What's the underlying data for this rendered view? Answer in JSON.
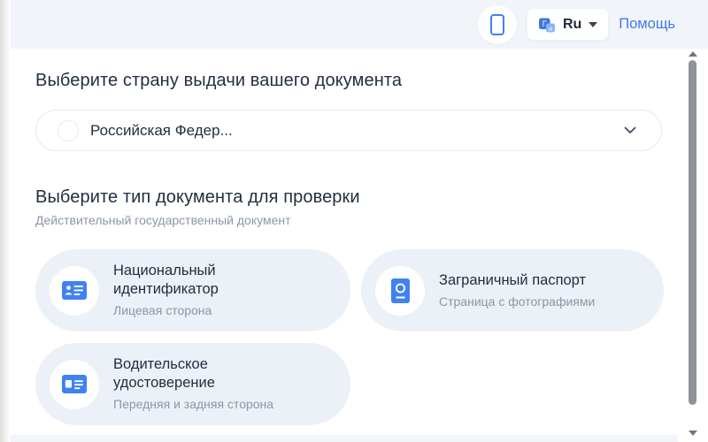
{
  "header": {
    "language_code": "Ru",
    "help_label": "Помощь"
  },
  "country_section": {
    "title": "Выберите страну выдачи вашего документа",
    "selected_country": "Российская Федер...",
    "flag": "russia-flag"
  },
  "document_section": {
    "title": "Выберите тип документа для проверки",
    "subtitle": "Действительный государственный документ",
    "options": [
      {
        "title": "Национальный идентификатор",
        "subtitle": "Лицевая сторона",
        "icon": "id-card-icon"
      },
      {
        "title": "Заграничный паспорт",
        "subtitle": "Страница с фотографиями",
        "icon": "passport-icon"
      },
      {
        "title": "Водительское удостоверение",
        "subtitle": "Передняя и задняя сторона",
        "icon": "drivers-license-icon"
      }
    ]
  },
  "colors": {
    "accent_blue": "#3f82f0",
    "link_blue": "#3e7bf0",
    "header_bg": "#f1f4f9",
    "card_bg": "#ecf1f7",
    "heading": "#222f3f",
    "secondary_text": "#8b96a5"
  }
}
